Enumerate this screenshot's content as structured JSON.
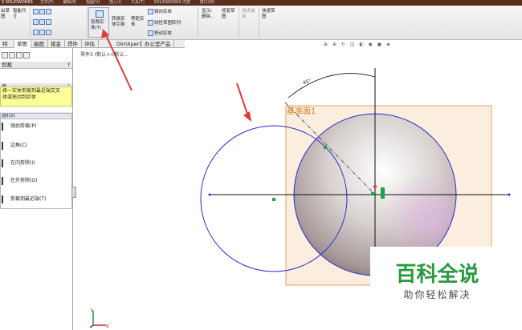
{
  "app": {
    "logo_text": "S SOLIDWORKS",
    "menu": [
      "文件(F)",
      "编辑(E)",
      "视图(V)",
      "插入(I)",
      "工具(T)",
      "SOLIDWORKS 内容",
      "窗口(W)"
    ]
  },
  "ribbon": {
    "exit_sketch": "出草\n图",
    "smart_dim": "智能尺\n寸",
    "trim": "剪裁实\n体(T)",
    "convert": "转换实\n体引用",
    "offset": "等距实\n体",
    "mirror": "镜向实体",
    "linear_pattern": "线性草图阵列",
    "move": "移动实体",
    "display_delete": "显示/\n删除...",
    "repair": "修复草\n图",
    "quick_snaps": "快速捕\n捉",
    "rapid_sketch": "快速草\n图"
  },
  "tabs": [
    "特征",
    "草图",
    "曲面",
    "钣金",
    "焊件",
    "评估",
    "DimXpert",
    "办公室产品"
  ],
  "active_tab": 1,
  "crumb": "零件3 (默认<<默认...",
  "panel": {
    "title": "剪裁",
    "msg_head": "息",
    "message": "择一实体剪裁到最近端交叉\n体或拖动到实体",
    "options_head": "项(O)",
    "options": [
      "强劲剪裁(P)",
      "边角(C)",
      "在内剪除(I)",
      "在外剪除(O)",
      "剪裁到最近端(T)"
    ]
  },
  "sketch": {
    "plane_label": "基准面1",
    "angle_label": "45°"
  },
  "watermark": {
    "title": "百科全说",
    "subtitle": "助你轻松解决"
  },
  "colors": {
    "sketch_curve": "#2b2bd0",
    "plane": "#e07a2a",
    "arrow": "#e03a3a",
    "relation": "#19a34a",
    "brand_green": "#2a9a3f"
  }
}
